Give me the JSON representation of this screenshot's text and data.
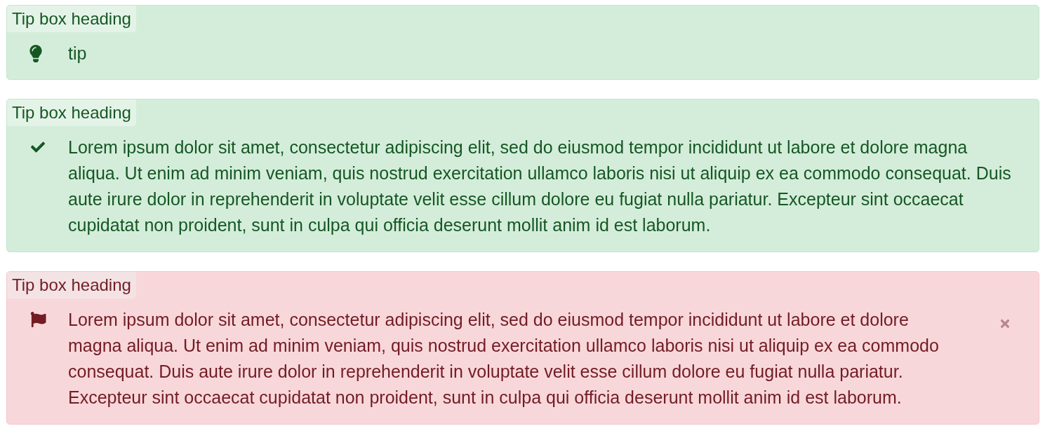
{
  "tip_boxes": [
    {
      "kind": "tip",
      "heading": "Tip box heading",
      "text": "tip",
      "dismissible": false
    },
    {
      "kind": "success",
      "heading": "Tip box heading",
      "text": "Lorem ipsum dolor sit amet, consectetur adipiscing elit, sed do eiusmod tempor incididunt ut labore et dolore magna aliqua. Ut enim ad minim veniam, quis nostrud exercitation ullamco laboris nisi ut aliquip ex ea commodo consequat. Duis aute irure dolor in reprehenderit in voluptate velit esse cillum dolore eu fugiat nulla pariatur. Excepteur sint occaecat cupidatat non proident, sunt in culpa qui officia deserunt mollit anim id est laborum.",
      "dismissible": false
    },
    {
      "kind": "danger",
      "heading": "Tip box heading",
      "text": "Lorem ipsum dolor sit amet, consectetur adipiscing elit, sed do eiusmod tempor incididunt ut labore et dolore magna aliqua. Ut enim ad minim veniam, quis nostrud exercitation ullamco laboris nisi ut aliquip ex ea commodo consequat. Duis aute irure dolor in reprehenderit in voluptate velit esse cillum dolore eu fugiat nulla pariatur. Excepteur sint occaecat cupidatat non proident, sunt in culpa qui officia deserunt mollit anim id est laborum.",
      "dismissible": true
    }
  ]
}
